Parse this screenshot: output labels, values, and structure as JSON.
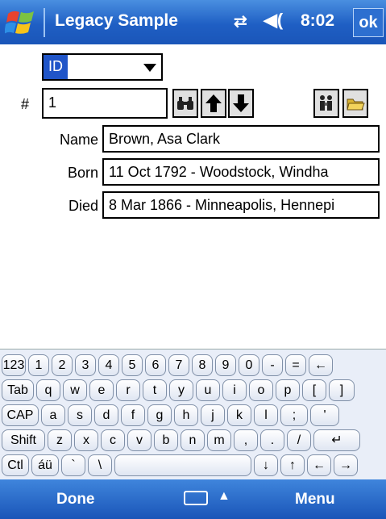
{
  "titlebar": {
    "title": "Legacy Sample",
    "time": "8:02",
    "ok_label": "ok",
    "conn_glyph": "⇄",
    "vol_glyph": "◀("
  },
  "form": {
    "field_select_value": "ID",
    "hash_label": "#",
    "number_value": "1",
    "name_label": "Name",
    "name_value": "Brown, Asa Clark",
    "born_label": "Born",
    "born_value": "11 Oct 1792 - Woodstock, Windha",
    "died_label": "Died",
    "died_value": "8 Mar 1866 - Minneapolis, Hennepi"
  },
  "keyboard": {
    "row1": [
      "123",
      "1",
      "2",
      "3",
      "4",
      "5",
      "6",
      "7",
      "8",
      "9",
      "0",
      "-",
      "=",
      "←"
    ],
    "row2": [
      "Tab",
      "q",
      "w",
      "e",
      "r",
      "t",
      "y",
      "u",
      "i",
      "o",
      "p",
      "[",
      "]"
    ],
    "row3": [
      "CAP",
      "a",
      "s",
      "d",
      "f",
      "g",
      "h",
      "j",
      "k",
      "l",
      ";",
      "'"
    ],
    "row4": [
      "Shift",
      "z",
      "x",
      "c",
      "v",
      "b",
      "n",
      "m",
      ",",
      ".",
      "/",
      "↵"
    ],
    "row5": [
      "Ctl",
      "áü",
      "`",
      "\\",
      "",
      "↓",
      "↑",
      "←",
      "→"
    ]
  },
  "bottombar": {
    "left_label": "Done",
    "right_label": "Menu",
    "caret": "▲"
  }
}
